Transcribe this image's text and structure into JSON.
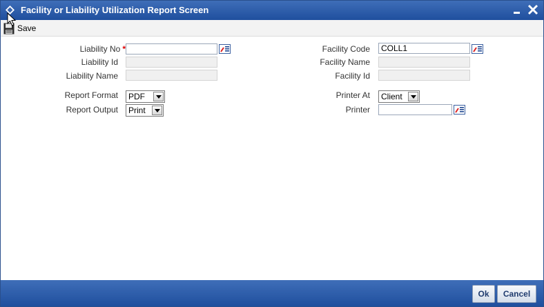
{
  "window": {
    "title": "Facility or Liability Utilization Report Screen"
  },
  "toolbar": {
    "save_label": "Save"
  },
  "form": {
    "liability_no": {
      "label": "Liability No",
      "required_mark": "*",
      "value": ""
    },
    "liability_id": {
      "label": "Liability Id",
      "value": ""
    },
    "liability_name": {
      "label": "Liability Name",
      "value": ""
    },
    "facility_code": {
      "label": "Facility Code",
      "value": "COLL1"
    },
    "facility_name": {
      "label": "Facility Name",
      "value": ""
    },
    "facility_id": {
      "label": "Facility Id",
      "value": ""
    },
    "report_format": {
      "label": "Report Format",
      "selected": "PDF"
    },
    "report_output": {
      "label": "Report Output",
      "selected": "Print"
    },
    "printer_at": {
      "label": "Printer At",
      "selected": "Client"
    },
    "printer": {
      "label": "Printer",
      "value": ""
    }
  },
  "footer": {
    "ok_label": "Ok",
    "cancel_label": "Cancel"
  },
  "icons": {
    "title": "diamond-icon",
    "minimize": "minimize-icon",
    "close": "close-icon",
    "save": "save-icon",
    "lov": "list-of-values-icon"
  },
  "colors": {
    "titlebar": "#2f5ea8",
    "required": "#dd0000",
    "footer": "#2f5ea8"
  }
}
